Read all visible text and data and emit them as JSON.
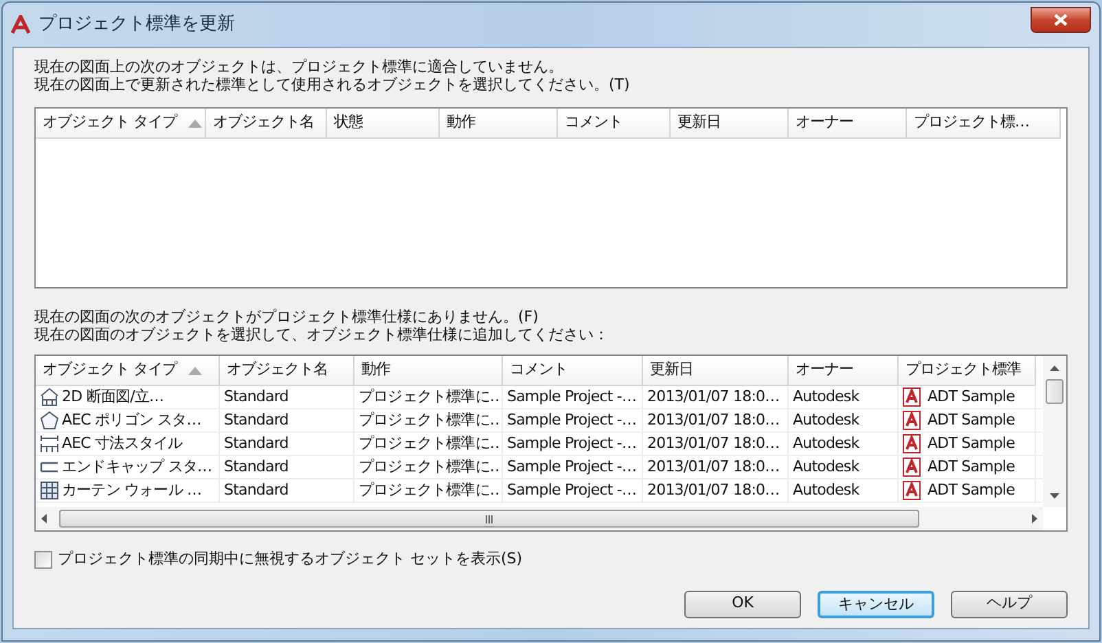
{
  "window": {
    "title": "プロジェクト標準を更新"
  },
  "nonconforming": {
    "description": [
      "現在の図面上の次のオブジェクトは、プロジェクト標準に適合していません。",
      "現在の図面上で更新された標準として使用されるオブジェクトを選択してください。(T)"
    ],
    "columns": [
      {
        "label": "オブジェクト タイプ",
        "sorted": true
      },
      {
        "label": "オブジェクト名",
        "sorted": false
      },
      {
        "label": "状態",
        "sorted": false
      },
      {
        "label": "動作",
        "sorted": false
      },
      {
        "label": "コメント",
        "sorted": false
      },
      {
        "label": "更新日",
        "sorted": false
      },
      {
        "label": "オーナー",
        "sorted": false
      },
      {
        "label": "プロジェクト標…",
        "sorted": false
      }
    ]
  },
  "missing": {
    "description": [
      "現在の図面の次のオブジェクトがプロジェクト標準仕様にありません。(F)",
      "現在の図面のオブジェクトを選択して、オブジェクト標準仕様に追加してください："
    ],
    "columns": [
      {
        "label": "オブジェクト タイプ",
        "sorted": true
      },
      {
        "label": "オブジェクト名",
        "sorted": false
      },
      {
        "label": "動作",
        "sorted": false
      },
      {
        "label": "コメント",
        "sorted": false
      },
      {
        "label": "更新日",
        "sorted": false
      },
      {
        "label": "オーナー",
        "sorted": false
      },
      {
        "label": "プロジェクト標準",
        "sorted": false
      }
    ],
    "rows": [
      {
        "cells": [
          "2D 断面図/立…",
          "Standard",
          "プロジェクト標準に…",
          "Sample Project -…",
          "2013/01/07 18:0…",
          "Autodesk",
          "ADT Sample"
        ]
      },
      {
        "cells": [
          "AEC ポリゴン スタ…",
          "Standard",
          "プロジェクト標準に…",
          "Sample Project -…",
          "2013/01/07 18:0…",
          "Autodesk",
          "ADT Sample"
        ]
      },
      {
        "cells": [
          "AEC 寸法スタイル",
          "Standard",
          "プロジェクト標準に…",
          "Sample Project -…",
          "2013/01/07 18:0…",
          "Autodesk",
          "ADT Sample"
        ]
      },
      {
        "cells": [
          "エンドキャップ スタ…",
          "Standard",
          "プロジェクト標準に…",
          "Sample Project -…",
          "2013/01/07 18:0…",
          "Autodesk",
          "ADT Sample"
        ]
      },
      {
        "cells": [
          "カーテン ウォール …",
          "Standard",
          "プロジェクト標準に…",
          "Sample Project -…",
          "2013/01/07 18:0…",
          "Autodesk",
          "ADT Sample"
        ]
      }
    ]
  },
  "show_ignored": {
    "label": "プロジェクト標準の同期中に無視するオブジェクト セットを表示(S)",
    "checked": false
  },
  "buttons": [
    {
      "label": "OK",
      "focused": false
    },
    {
      "label": "キャンセル",
      "focused": true
    },
    {
      "label": "ヘルプ",
      "focused": false
    }
  ]
}
